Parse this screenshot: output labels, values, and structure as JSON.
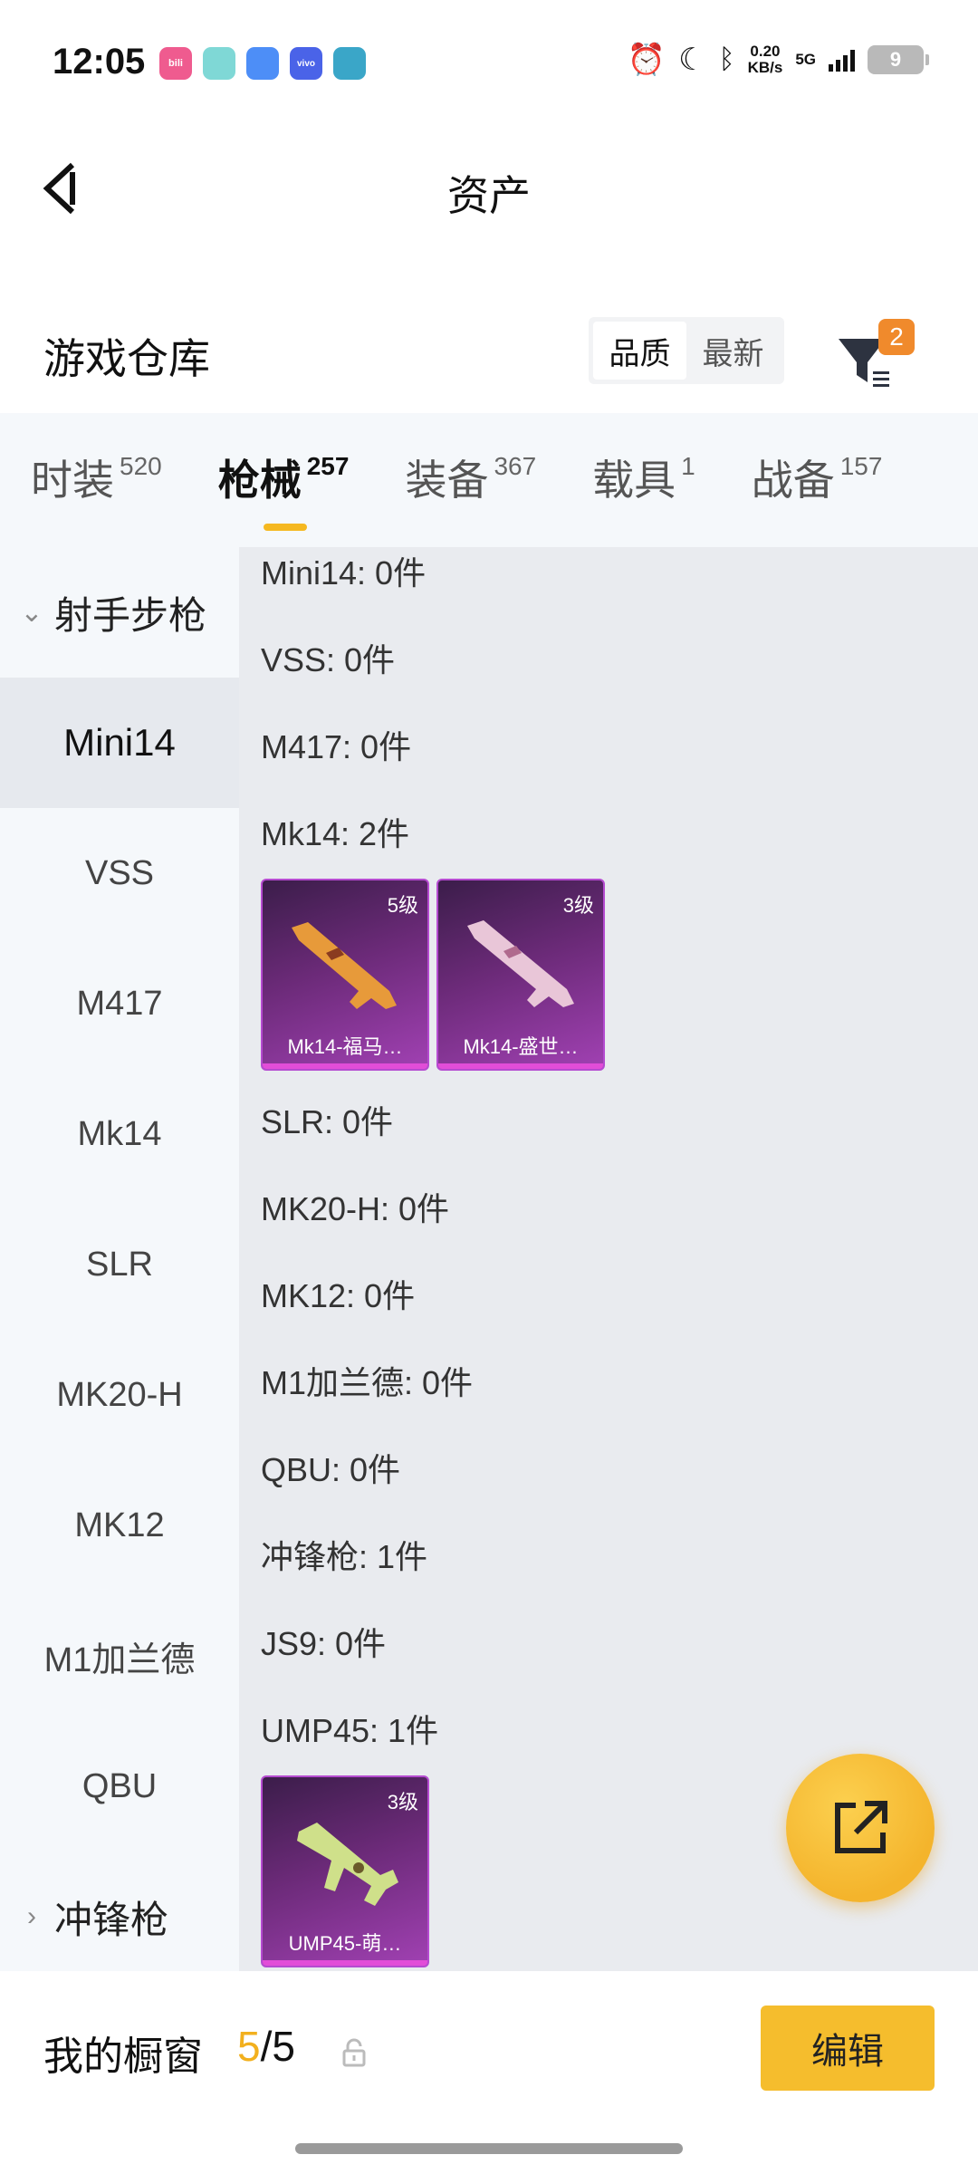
{
  "status_bar": {
    "time": "12:05",
    "apps": [
      {
        "icon": "bilibili-icon",
        "text": "bili",
        "color": "#ef5b8f"
      },
      {
        "icon": "chat-icon",
        "text": "",
        "color": "#7fd8d6"
      },
      {
        "icon": "files-icon",
        "text": "",
        "color": "#4d8ef7"
      },
      {
        "icon": "vivo-icon",
        "text": "vivo",
        "color": "#4a63e8"
      },
      {
        "icon": "mobile-icon",
        "text": "",
        "color": "#3aa6c8"
      }
    ],
    "net_speed_value": "0.20",
    "net_speed_unit": "KB/s",
    "network": "5G",
    "battery": "9"
  },
  "header": {
    "title": "资产"
  },
  "section": {
    "title": "游戏仓库",
    "sort_options": [
      "品质",
      "最新"
    ],
    "filter_badge": "2"
  },
  "tabs": [
    {
      "label": "时装",
      "count": "520"
    },
    {
      "label": "枪械",
      "count": "257"
    },
    {
      "label": "装备",
      "count": "367"
    },
    {
      "label": "载具",
      "count": "1"
    },
    {
      "label": "战备",
      "count": "157"
    }
  ],
  "categories": {
    "group_open": "射手步枪",
    "items": [
      "Mini14",
      "VSS",
      "M417",
      "Mk14",
      "SLR",
      "MK20-H",
      "MK12",
      "M1加兰德",
      "QBU"
    ],
    "group_closed": "冲锋枪"
  },
  "content": {
    "rows": [
      "Mini14: 0件",
      "VSS: 0件",
      "M417: 0件",
      "Mk14: 2件",
      "SLR: 0件",
      "MK20-H: 0件",
      "MK12: 0件",
      "M1加兰德: 0件",
      "QBU: 0件",
      "冲锋枪: 1件",
      "JS9: 0件",
      "UMP45: 1件"
    ],
    "mk14_cards": [
      {
        "level": "5级",
        "name": "Mk14-福马…"
      },
      {
        "level": "3级",
        "name": "Mk14-盛世…"
      }
    ],
    "ump45_cards": [
      {
        "level": "3级",
        "name": "UMP45-萌…"
      }
    ]
  },
  "bottom": {
    "showcase_label": "我的橱窗",
    "showcase_current": "5",
    "showcase_total": "/5",
    "edit_label": "编辑"
  },
  "colors": {
    "accent": "#f5bd2d",
    "badge": "#f08a2c",
    "card_purple": "#6b2a78"
  }
}
